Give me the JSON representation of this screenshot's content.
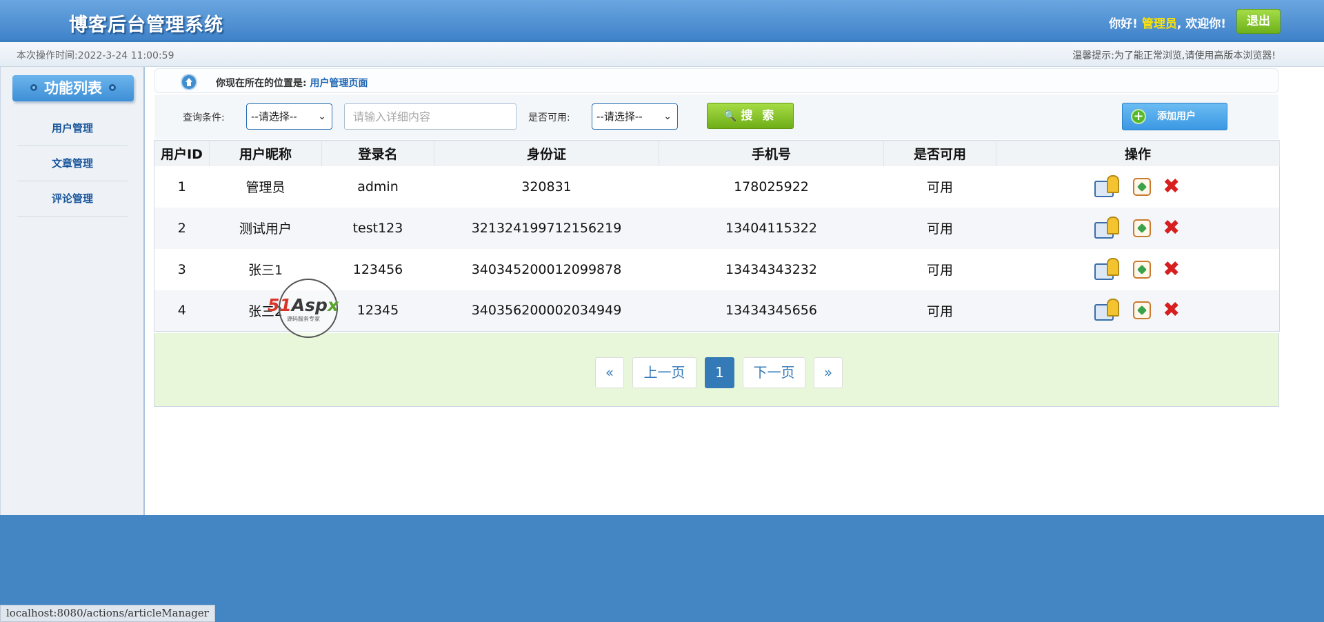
{
  "header": {
    "title": "博客后台管理系统",
    "greeting_prefix": "你好!",
    "user_name": "管理员",
    "greeting_suffix": ", 欢迎你!",
    "logout_label": "退出"
  },
  "infobar": {
    "op_time": "本次操作时间:2022-3-24 11:00:59",
    "tip": "温馨提示:为了能正常浏览,请使用高版本浏览器!"
  },
  "sidebar": {
    "title": "功能列表",
    "items": [
      {
        "label": "用户管理"
      },
      {
        "label": "文章管理"
      },
      {
        "label": "评论管理"
      }
    ]
  },
  "breadcrumb": {
    "prefix": "你现在所在的位置是:",
    "page": "用户管理页面"
  },
  "toolbar": {
    "query_label": "查询条件:",
    "query_select": "--请选择--",
    "input_placeholder": "请输入详细内容",
    "avail_label": "是否可用:",
    "avail_select": "--请选择--",
    "search_label": "搜 索",
    "add_label": "添加用户"
  },
  "table": {
    "headers": [
      "用户ID",
      "用户昵称",
      "登录名",
      "身份证",
      "手机号",
      "是否可用",
      "操作"
    ],
    "rows": [
      {
        "id": "1",
        "nick": "管理员",
        "login": "admin",
        "idcard": "320831",
        "phone": "178025922",
        "avail": "可用"
      },
      {
        "id": "2",
        "nick": "测试用户",
        "login": "test123",
        "idcard": "321324199712156219",
        "phone": "13404115322",
        "avail": "可用"
      },
      {
        "id": "3",
        "nick": "张三1",
        "login": "123456",
        "idcard": "340345200012099878",
        "phone": "13434343232",
        "avail": "可用"
      },
      {
        "id": "4",
        "nick": "张三2",
        "login": "12345",
        "idcard": "340356200002034949",
        "phone": "13434345656",
        "avail": "可用"
      }
    ]
  },
  "pager": {
    "first": "«",
    "prev": "上一页",
    "current": "1",
    "next": "下一页",
    "last": "»"
  },
  "watermark": {
    "brand_a": "51",
    "brand_b": "Asp",
    "brand_c": "x",
    "slogan": "源码服务专家"
  },
  "status_url": "localhost:8080/actions/articleManager"
}
